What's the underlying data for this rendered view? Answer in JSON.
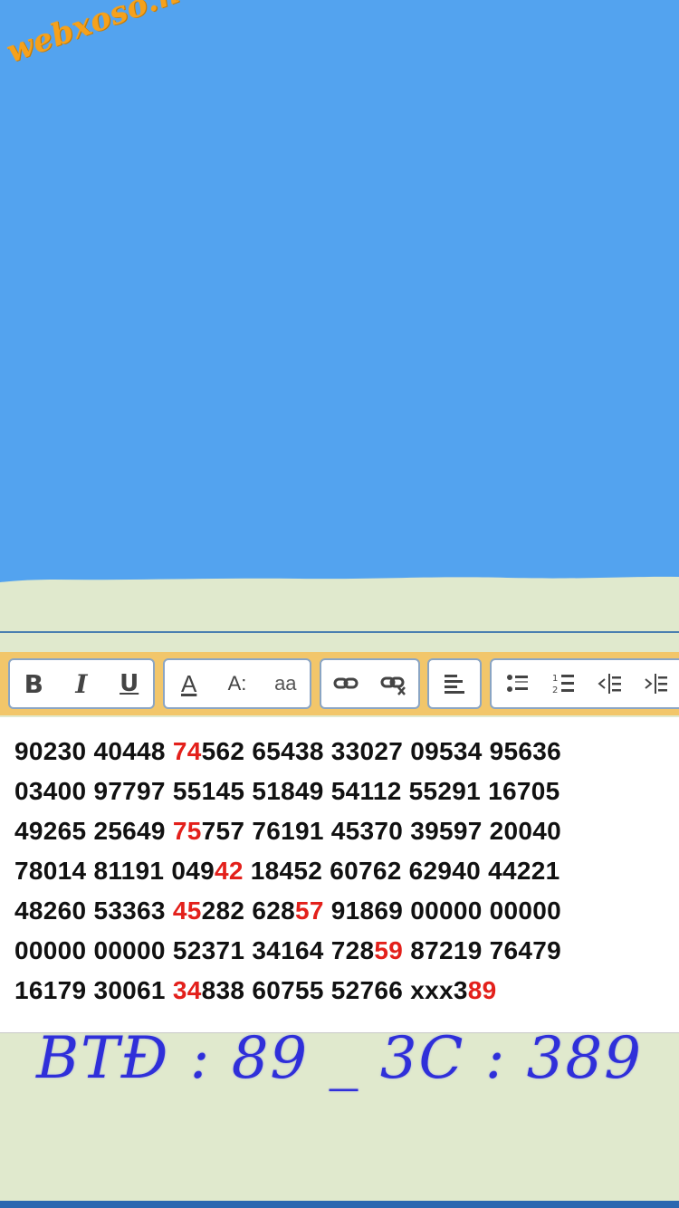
{
  "watermark": {
    "text": "webxoso.net"
  },
  "colors": {
    "sky": "#53a3ef",
    "page_bg": "#e0e9cd",
    "toolbar": "#f2c66a",
    "highlight": "#e3201b",
    "caption": "#2f2fd9",
    "watermark": "#f5a11c"
  },
  "toolbar": {
    "groups": [
      {
        "buttons": [
          {
            "icon": "bold-icon",
            "label": "B"
          },
          {
            "icon": "italic-icon",
            "label": "I"
          },
          {
            "icon": "underline-icon",
            "label": "U"
          }
        ]
      },
      {
        "buttons": [
          {
            "icon": "font-color-icon",
            "label": "A"
          },
          {
            "icon": "font-size-icon",
            "label": "A:"
          },
          {
            "icon": "font-family-icon",
            "label": "aa"
          }
        ]
      },
      {
        "buttons": [
          {
            "icon": "link-icon"
          },
          {
            "icon": "unlink-icon"
          }
        ]
      },
      {
        "buttons": [
          {
            "icon": "align-left-icon"
          }
        ]
      },
      {
        "buttons": [
          {
            "icon": "bullet-list-icon"
          },
          {
            "icon": "numbered-list-icon"
          },
          {
            "icon": "outdent-icon"
          },
          {
            "icon": "indent-icon"
          }
        ]
      }
    ]
  },
  "editor": {
    "lines": [
      [
        {
          "t": "90230 40448 "
        },
        {
          "t": "74",
          "r": true
        },
        {
          "t": "562 65438 33027 09534 95636"
        }
      ],
      [
        {
          "t": "03400 97797 55145 51849 54112 55291 16705"
        }
      ],
      [
        {
          "t": "49265 25649 "
        },
        {
          "t": "75",
          "r": true
        },
        {
          "t": "757 76191 45370 39597 20040"
        }
      ],
      [
        {
          "t": "78014 81191 049"
        },
        {
          "t": "42",
          "r": true
        },
        {
          "t": " 18452 60762 62940 44221"
        }
      ],
      [
        {
          "t": "48260 53363 "
        },
        {
          "t": "45",
          "r": true
        },
        {
          "t": "282 628"
        },
        {
          "t": "57",
          "r": true
        },
        {
          "t": " 91869 00000 00000"
        }
      ],
      [
        {
          "t": "00000 00000 52371 34164 728"
        },
        {
          "t": "59",
          "r": true
        },
        {
          "t": " 87219 76479"
        }
      ],
      [
        {
          "t": "16179 30061 "
        },
        {
          "t": "34",
          "r": true
        },
        {
          "t": "838 60755 52766 xxx3"
        },
        {
          "t": "89",
          "r": true
        }
      ]
    ]
  },
  "caption": {
    "text": "BTĐ : 89 _ 3C : 389"
  }
}
